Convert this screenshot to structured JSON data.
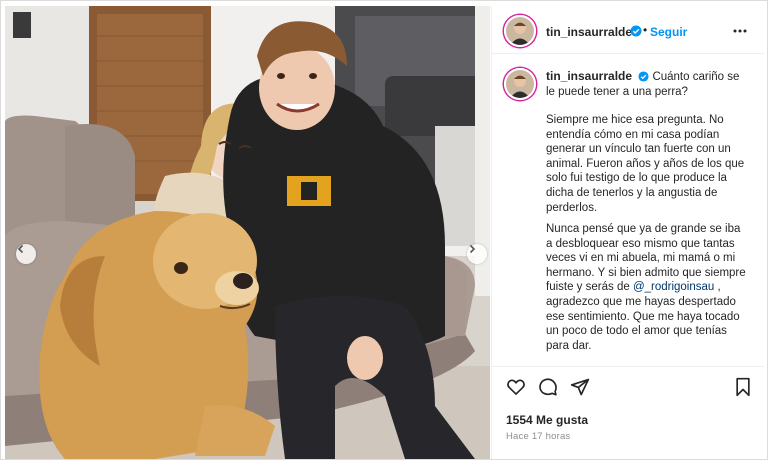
{
  "post": {
    "username": "tin_insaurralde",
    "follow_label": "Seguir",
    "dot": "•",
    "caption_first": "Cuánto cariño se le puede tener a una perra?",
    "caption_p1": "Siempre me hice esa pregunta. No entendía cómo en mi casa podían generar un vínculo tan fuerte con un animal. Fueron años y años de los que solo fui testigo de lo que produce la dicha de tenerlos y la angustia de perderlos.",
    "caption_p2_a": "Nunca pensé que ya de grande se iba a desbloquear eso mismo que tantas veces vi en mi abuela, mi mamá o mi hermano. Y si bien admito que siempre fuiste y serás de",
    "mention": "@_rodrigoinsau",
    "caption_p2_b": ", agradezco que me hayas despertado ese sentimiento. Que me haya tocado un poco de todo el amor que tenías para dar.",
    "likes": "1554 Me gusta",
    "time": "Hace 17 horas"
  },
  "icons": {
    "verified": "verified-badge-icon",
    "more": "more-options-icon",
    "like": "heart-icon",
    "comment": "comment-icon",
    "share": "share-icon",
    "save": "bookmark-icon",
    "prev": "chevron-left-icon",
    "next": "chevron-right-icon"
  },
  "colors": {
    "link_blue": "#0095f6",
    "verified_blue": "#0095f6",
    "mention_blue": "#00376b",
    "muted": "#8e8e8e",
    "text": "#262626"
  }
}
